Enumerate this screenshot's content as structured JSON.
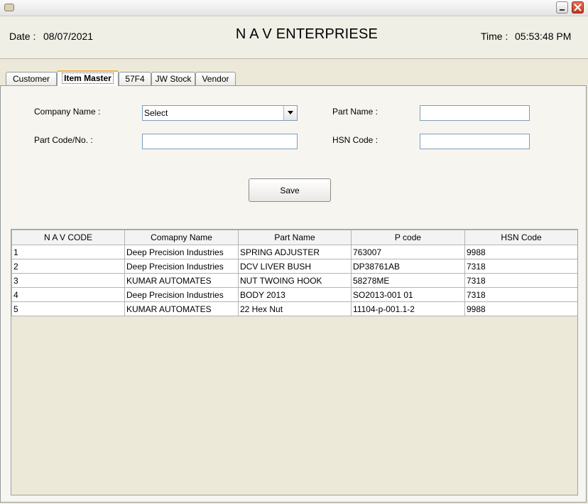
{
  "window": {
    "icon": "cup-icon",
    "minimize_icon": "minimize-icon",
    "close_icon": "close-icon"
  },
  "header": {
    "date_label": "Date :",
    "date_value": "08/07/2021",
    "title": "N A V ENTERPRIESE",
    "time_label": "Time :",
    "time_value": "05:53:48 PM"
  },
  "tabs": [
    {
      "label": "Customer"
    },
    {
      "label": "Item Master",
      "active": true
    },
    {
      "label": "57F4"
    },
    {
      "label": "JW Stock"
    },
    {
      "label": "Vendor"
    }
  ],
  "form": {
    "company_name_label": "Company Name :",
    "company_name_value": "Select",
    "part_name_label": "Part Name :",
    "part_name_value": "",
    "part_code_label": "Part Code/No. :",
    "part_code_value": "",
    "hsn_code_label": "HSN Code :",
    "hsn_code_value": "",
    "save_label": "Save"
  },
  "table": {
    "columns": [
      "N A V CODE",
      "Comapny Name",
      "Part Name",
      "P code",
      "HSN Code"
    ],
    "rows": [
      [
        "1",
        "Deep Precision Industries",
        "SPRING ADJUSTER",
        "763007",
        "9988"
      ],
      [
        "2",
        "Deep Precision Industries",
        "DCV LIVER BUSH",
        "DP38761AB",
        "7318"
      ],
      [
        "3",
        "KUMAR AUTOMATES",
        "NUT TWOING HOOK",
        "58278ME",
        "7318"
      ],
      [
        "4",
        "Deep Precision Industries",
        "BODY 2013",
        "SO2013-001 01",
        "7318"
      ],
      [
        "5",
        "KUMAR AUTOMATES",
        "22 Hex Nut",
        "11104-p-001.1-2",
        "9988"
      ]
    ]
  },
  "colors": {
    "window_bg": "#ece9d8",
    "active_tab_accent": "#f5b33a",
    "input_border": "#7f9db9",
    "close_button": "#c2361c"
  }
}
